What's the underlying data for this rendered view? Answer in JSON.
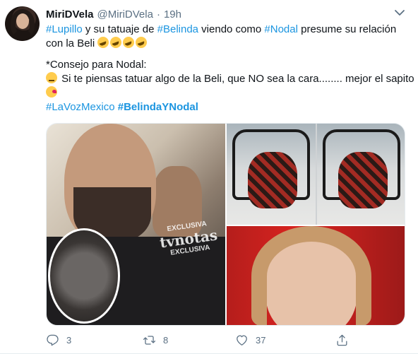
{
  "tweet": {
    "display_name": "MiriDVela",
    "handle": "@MiriDVela",
    "separator": "·",
    "time": "19h",
    "text": {
      "line1": {
        "ht1": "#Lupillo",
        "t1": " y su tatuaje de ",
        "ht2": "#Belinda",
        "t2": " viendo como ",
        "ht3": "#Nodal",
        "t3": " presume su relación"
      },
      "line2": "con la Beli ",
      "line3": "*Consejo para Nodal:",
      "line4": " Si te piensas tatuar algo de la Beli, que NO sea la cara........ mejor el sapito",
      "hashtags": {
        "ht1": "#LaVozMexico",
        "ht2": "#BelindaYNodal"
      }
    },
    "media": {
      "watermark_top": "EXCLUSIVA",
      "watermark_big": "tvnotas",
      "watermark_bottom": "EXCLUSIVA"
    },
    "actions": {
      "reply_count": "3",
      "retweet_count": "8",
      "like_count": "37"
    }
  },
  "icons": {
    "more": "chevron-down-icon",
    "reply": "reply-icon",
    "retweet": "retweet-icon",
    "like": "heart-icon",
    "share": "share-icon"
  },
  "colors": {
    "hashtag": "#1b95e0",
    "muted": "#5b7083",
    "text": "#0f1419"
  }
}
